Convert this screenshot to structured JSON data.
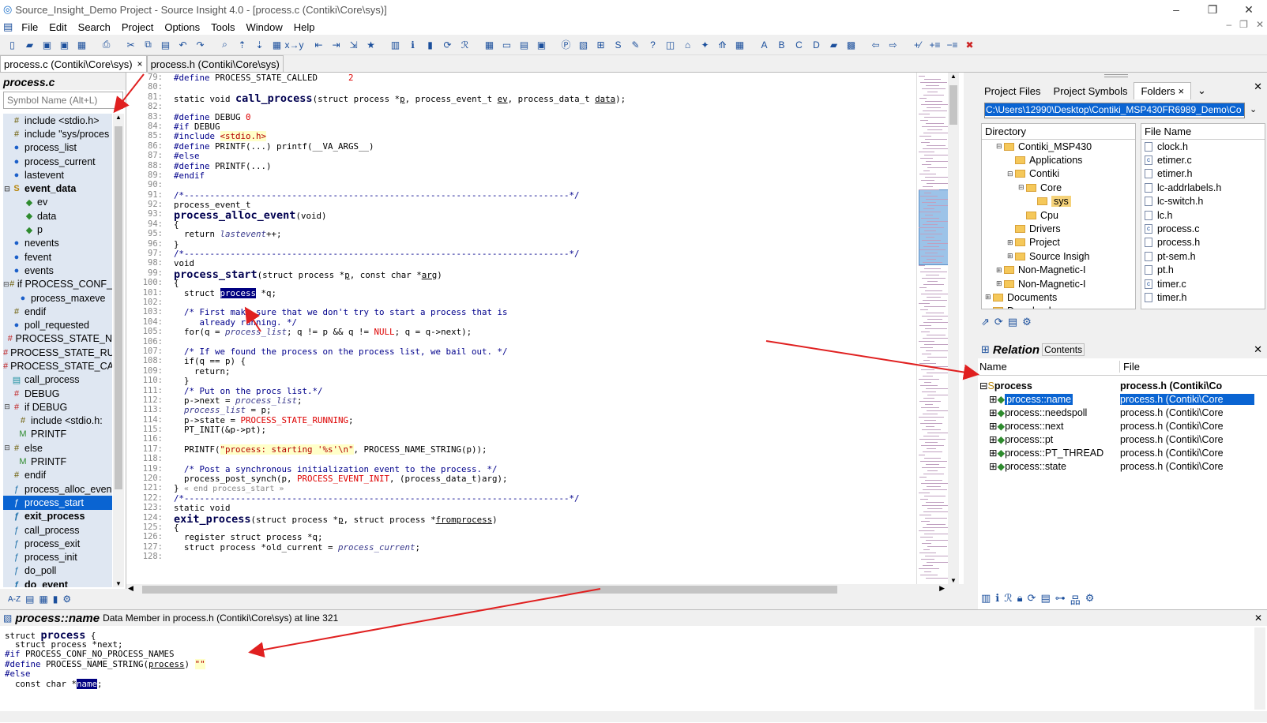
{
  "window": {
    "title": "Source_Insight_Demo Project - Source Insight 4.0 - [process.c (Contiki\\Core\\sys)]"
  },
  "menu": [
    "File",
    "Edit",
    "Search",
    "Project",
    "Options",
    "Tools",
    "Window",
    "Help"
  ],
  "tabs": [
    {
      "label": "process.c (Contiki\\Core\\sys)",
      "close": "×"
    },
    {
      "label": "process.h (Contiki\\Core\\sys)"
    }
  ],
  "symbol_window": {
    "title": "process.c",
    "search_placeholder": "Symbol Name (Alt+L)",
    "items": [
      {
        "exp": "",
        "icon": "#",
        "label": "include <stdio.h>"
      },
      {
        "exp": "",
        "icon": "#",
        "label": "include \"sys/proces"
      },
      {
        "exp": "",
        "icon": "●",
        "label": "process_list"
      },
      {
        "exp": "",
        "icon": "●",
        "label": "process_current"
      },
      {
        "exp": "",
        "icon": "●",
        "label": "lastevent"
      },
      {
        "exp": "⊟",
        "icon": "S",
        "label": "event_data",
        "bold": true
      },
      {
        "exp": "",
        "icon": "◆",
        "label": "ev",
        "indent": 2
      },
      {
        "exp": "",
        "icon": "◆",
        "label": "data",
        "indent": 2
      },
      {
        "exp": "",
        "icon": "◆",
        "label": "p",
        "indent": 2
      },
      {
        "exp": "",
        "icon": "●",
        "label": "nevents"
      },
      {
        "exp": "",
        "icon": "●",
        "label": "fevent"
      },
      {
        "exp": "",
        "icon": "●",
        "label": "events"
      },
      {
        "exp": "⊟",
        "icon": "#",
        "label": "if PROCESS_CONF_"
      },
      {
        "exp": "",
        "icon": "●",
        "label": "process_maxeve",
        "indent": 1
      },
      {
        "exp": "",
        "icon": "#",
        "label": "endif"
      },
      {
        "exp": "",
        "icon": "●",
        "label": "poll_requested"
      },
      {
        "exp": "",
        "icon": "#",
        "label": "PROCESS_STATE_N"
      },
      {
        "exp": "",
        "icon": "#",
        "label": "PROCESS_STATE_RU"
      },
      {
        "exp": "",
        "icon": "#",
        "label": "PROCESS_STATE_CA"
      },
      {
        "exp": "",
        "icon": "▤",
        "label": "call_process"
      },
      {
        "exp": "",
        "icon": "#",
        "label": "DEBUG"
      },
      {
        "exp": "⊟",
        "icon": "#",
        "label": "if DEBUG"
      },
      {
        "exp": "",
        "icon": "#",
        "label": "include <stdio.h:",
        "indent": 1
      },
      {
        "exp": "",
        "icon": "M",
        "label": "PRINTF",
        "indent": 1
      },
      {
        "exp": "⊟",
        "icon": "#",
        "label": "else"
      },
      {
        "exp": "",
        "icon": "M",
        "label": "PRINTF",
        "indent": 1
      },
      {
        "exp": "",
        "icon": "#",
        "label": "endif"
      },
      {
        "exp": "",
        "icon": "ƒ",
        "label": "process_alloc_even"
      },
      {
        "exp": "",
        "icon": "ƒ",
        "label": "process_start",
        "selected": true
      },
      {
        "exp": "",
        "icon": "ƒ",
        "label": "exit_process",
        "bold": true
      },
      {
        "exp": "",
        "icon": "ƒ",
        "label": "call_process"
      },
      {
        "exp": "",
        "icon": "ƒ",
        "label": "process_exit"
      },
      {
        "exp": "",
        "icon": "ƒ",
        "label": "process_init"
      },
      {
        "exp": "",
        "icon": "ƒ",
        "label": "do_poll"
      },
      {
        "exp": "",
        "icon": "ƒ",
        "label": "do_event",
        "bold": true
      }
    ],
    "bottom_icons": [
      "A-Z",
      "list-icon",
      "tree-icon",
      "book-icon",
      "gear-icon"
    ]
  },
  "editor": {
    "line_numbers": [
      "79:",
      "80:",
      "81:",
      "82:",
      "83:",
      "84:",
      "85:",
      "86:",
      "87:",
      "88:",
      "89:",
      "90:",
      "91:",
      "92:",
      "93:",
      "94:",
      "95:",
      "96:",
      "97:",
      "98:",
      "99:",
      "100:",
      "101:",
      "102:",
      "103:",
      "104:",
      "105:",
      "106:",
      "107:",
      "108:",
      "109:",
      "110:",
      "111:",
      "112:",
      "113:",
      "114:",
      "115:",
      "116:",
      "117:",
      "118:",
      "119:",
      "120:",
      "121:",
      "122:",
      "123:",
      "124:",
      "125:",
      "126:",
      "127:",
      "128:"
    ],
    "big_lines": [
      2,
      14,
      20,
      45
    ],
    "lines": [
      "#define PROCESS_STATE_CALLED      2",
      "",
      "static void call_process(struct process *p, process_event_t ev, process_data_t data);",
      "",
      "#define DEBUG 0",
      "#if DEBUG",
      "#include <stdio.h>",
      "#define PRINTF(...) printf(__VA_ARGS__)",
      "#else",
      "#define PRINTF(...)",
      "#endif",
      "",
      "/*---------------------------------------------------------------------------*/",
      "process_event_t",
      "process_alloc_event(void)",
      "{",
      "  return lastevent++;",
      "}",
      "/*---------------------------------------------------------------------------*/",
      "void",
      "process_start(struct process *p, const char *arg)",
      "{",
      "  struct process *q;",
      "",
      "  /* First make sure that we don't try to start a process that is",
      "     already running. */",
      "  for(q = process_list; q != p && q != NULL; q = q->next);",
      "",
      "  /* If we found the process on the process list, we bail out. */",
      "  if(q == p) {",
      "    return;",
      "  }",
      "  /* Put on the procs list.*/",
      "  p->next = process_list;",
      "  process_list = p;",
      "  p->state = PROCESS_STATE_RUNNING;",
      "  PT_INIT(&p->pt);",
      "",
      "  PRINTF(\"process: starting '%s'\\n\", PROCESS_NAME_STRING(p));",
      "",
      "  /* Post a synchronous initialization event to the process. */",
      "  process_post_synch(p, PROCESS_EVENT_INIT, (process_data_t)arg);",
      "} « end process_start »",
      "/*---------------------------------------------------------------------------*/",
      "static void",
      "exit_process(struct process *p, struct process *fromprocess)",
      "{",
      "  register struct process *q;",
      "  struct process *old_current = process_current;",
      ""
    ]
  },
  "project_window": {
    "tabs": [
      "Project Files",
      "Project Symbols",
      "Folders"
    ],
    "folders_close": "×",
    "path": "C:\\Users\\12990\\Desktop\\Contiki_MSP430FR6989_Demo\\Co",
    "dir_header": "Directory",
    "file_header": "File Name",
    "dirs": [
      {
        "label": "Contiki_MSP430",
        "level": 3,
        "exp": "⊟"
      },
      {
        "label": "Applications",
        "level": 4,
        "exp": ""
      },
      {
        "label": "Contiki",
        "level": 4,
        "exp": "⊟"
      },
      {
        "label": "Core",
        "level": 5,
        "exp": "⊟"
      },
      {
        "label": "sys",
        "level": 6,
        "exp": "",
        "selected": true
      },
      {
        "label": "Cpu",
        "level": 5,
        "exp": ""
      },
      {
        "label": "Drivers",
        "level": 4,
        "exp": ""
      },
      {
        "label": "Project",
        "level": 4,
        "exp": "⊞"
      },
      {
        "label": "Source Insigh",
        "level": 4,
        "exp": "⊞"
      },
      {
        "label": "Non-Magnetic-I",
        "level": 3,
        "exp": "⊞"
      },
      {
        "label": "Non-Magnetic-I",
        "level": 3,
        "exp": "⊞"
      },
      {
        "label": "Documents",
        "level": 2,
        "exp": "⊞"
      },
      {
        "label": "Downloads",
        "level": 2,
        "exp": ""
      }
    ],
    "files": [
      {
        "label": "clock.h",
        "kind": "h"
      },
      {
        "label": "etimer.c",
        "kind": "c"
      },
      {
        "label": "etimer.h",
        "kind": "h"
      },
      {
        "label": "lc-addrlabels.h",
        "kind": "h"
      },
      {
        "label": "lc-switch.h",
        "kind": "h"
      },
      {
        "label": "lc.h",
        "kind": "h"
      },
      {
        "label": "process.c",
        "kind": "c"
      },
      {
        "label": "process.h",
        "kind": "h"
      },
      {
        "label": "pt-sem.h",
        "kind": "h"
      },
      {
        "label": "pt.h",
        "kind": "h"
      },
      {
        "label": "timer.c",
        "kind": "c"
      },
      {
        "label": "timer.h",
        "kind": "h"
      }
    ]
  },
  "relation_window": {
    "title": "Relation",
    "contents": "Contents",
    "col_name": "Name",
    "col_file": "File",
    "rows": [
      {
        "name": "process",
        "file": "process.h (Contiki\\Co",
        "root": true
      },
      {
        "name": "process::name",
        "file": "process.h (Contiki\\Core",
        "selected": true
      },
      {
        "name": "process::needspoll",
        "file": "process.h (Contiki\\Core"
      },
      {
        "name": "process::next",
        "file": "process.h (Contiki\\Core"
      },
      {
        "name": "process::pt",
        "file": "process.h (Contiki\\Core"
      },
      {
        "name": "process::PT_THREAD",
        "file": "process.h (Contiki\\Core"
      },
      {
        "name": "process::state",
        "file": "process.h (Contiki\\Core"
      }
    ]
  },
  "context_window": {
    "symbol": "process::name",
    "desc": "Data Member in process.h (Contiki\\Core\\sys) at line 321",
    "lines": [
      "struct process {",
      "  struct process *next;",
      "#if PROCESS_CONF_NO_PROCESS_NAMES",
      "#define PROCESS_NAME_STRING(process) \"\"",
      "#else",
      "  const char *name;"
    ]
  },
  "colors": {
    "selection": "#0a64d2",
    "keyword": "#00008b",
    "number": "#dd0000",
    "arrow": "#e02020"
  }
}
